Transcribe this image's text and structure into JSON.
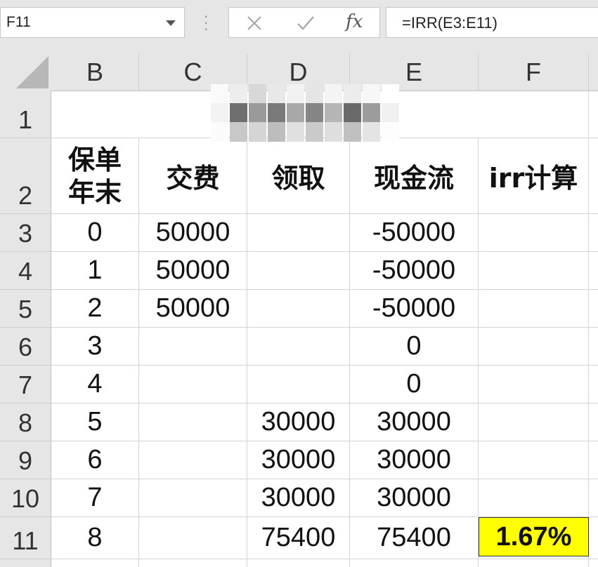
{
  "formula_bar": {
    "name_box": "F11",
    "formula": "=IRR(E3:E11)",
    "cancel_icon": "x-icon",
    "enter_icon": "check-icon",
    "function_icon": "fx"
  },
  "columns": [
    "B",
    "C",
    "D",
    "E",
    "F"
  ],
  "rows": [
    "1",
    "2",
    "3",
    "4",
    "5",
    "6",
    "7",
    "8",
    "9",
    "10",
    "11"
  ],
  "headers": {
    "b": "保单\n年末",
    "c": "交费",
    "d": "领取",
    "e": "现金流",
    "f": "irr计算"
  },
  "data_rows": [
    {
      "b": "0",
      "c": "50000",
      "d": "",
      "e": "-50000",
      "f": ""
    },
    {
      "b": "1",
      "c": "50000",
      "d": "",
      "e": "-50000",
      "f": ""
    },
    {
      "b": "2",
      "c": "50000",
      "d": "",
      "e": "-50000",
      "f": ""
    },
    {
      "b": "3",
      "c": "",
      "d": "",
      "e": "0",
      "f": ""
    },
    {
      "b": "4",
      "c": "",
      "d": "",
      "e": "0",
      "f": ""
    },
    {
      "b": "5",
      "c": "",
      "d": "30000",
      "e": "30000",
      "f": ""
    },
    {
      "b": "6",
      "c": "",
      "d": "30000",
      "e": "30000",
      "f": ""
    },
    {
      "b": "7",
      "c": "",
      "d": "30000",
      "e": "30000",
      "f": ""
    },
    {
      "b": "8",
      "c": "",
      "d": "75400",
      "e": "75400",
      "f": "1.67%"
    }
  ],
  "colors": {
    "result_fill": "#ffff00",
    "header_bg": "#e6e6e6",
    "grid_line": "#d4d4d4"
  }
}
